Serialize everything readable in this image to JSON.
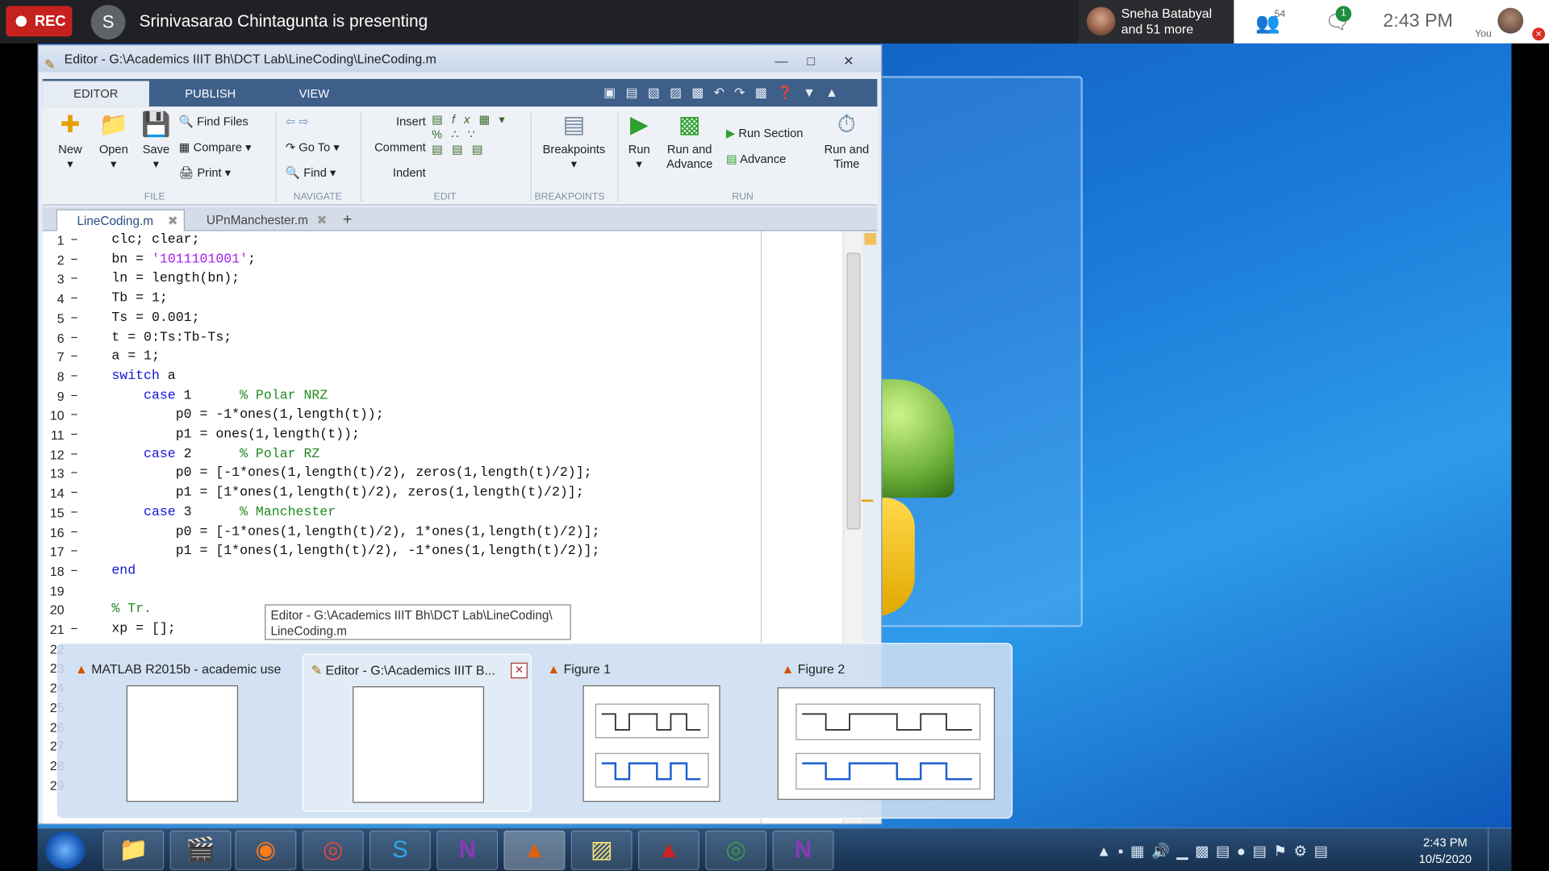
{
  "meet": {
    "rec_label": "REC",
    "presenter_initial": "S",
    "presenting_text": "Srinivasarao Chintagunta is presenting",
    "participants_preview_line1": "Sneha Batabyal",
    "participants_preview_line2": "and 51 more",
    "participant_count": "54",
    "chat_badge": "1",
    "time": "2:43 PM",
    "you_label": "You"
  },
  "editor": {
    "title": "Editor - G:\\Academics IIIT Bh\\DCT Lab\\LineCoding\\LineCoding.m",
    "tabs": [
      "EDITOR",
      "PUBLISH",
      "VIEW"
    ],
    "file_group": {
      "label": "FILE",
      "new": "New",
      "open": "Open",
      "save": "Save",
      "find_files": "Find Files",
      "compare": "Compare",
      "print": "Print"
    },
    "navigate_group": {
      "label": "NAVIGATE",
      "go_to": "Go To",
      "find": "Find"
    },
    "edit_group": {
      "label": "EDIT",
      "insert": "Insert",
      "comment": "Comment",
      "indent": "Indent"
    },
    "breakpoints_group": {
      "label": "BREAKPOINTS",
      "breakpoints": "Breakpoints"
    },
    "run_group": {
      "label": "RUN",
      "run": "Run",
      "run_and_advance_1": "Run and",
      "run_and_advance_2": "Advance",
      "run_section": "Run Section",
      "advance": "Advance",
      "run_and_time_1": "Run and",
      "run_and_time_2": "Time"
    },
    "doc_tabs": [
      "LineCoding.m",
      "UPnManchester.m"
    ],
    "tooltip_line1": "Editor - G:\\Academics IIIT Bh\\DCT Lab\\LineCoding\\",
    "tooltip_line2": "LineCoding.m"
  },
  "switcher": {
    "items": [
      {
        "title": "MATLAB R2015b - academic use"
      },
      {
        "title": "Editor - G:\\Academics IIIT B..."
      },
      {
        "title": "Figure 1"
      },
      {
        "title": "Figure 2"
      }
    ]
  },
  "taskbar": {
    "clock_time": "2:43 PM",
    "clock_date": "10/5/2020"
  }
}
